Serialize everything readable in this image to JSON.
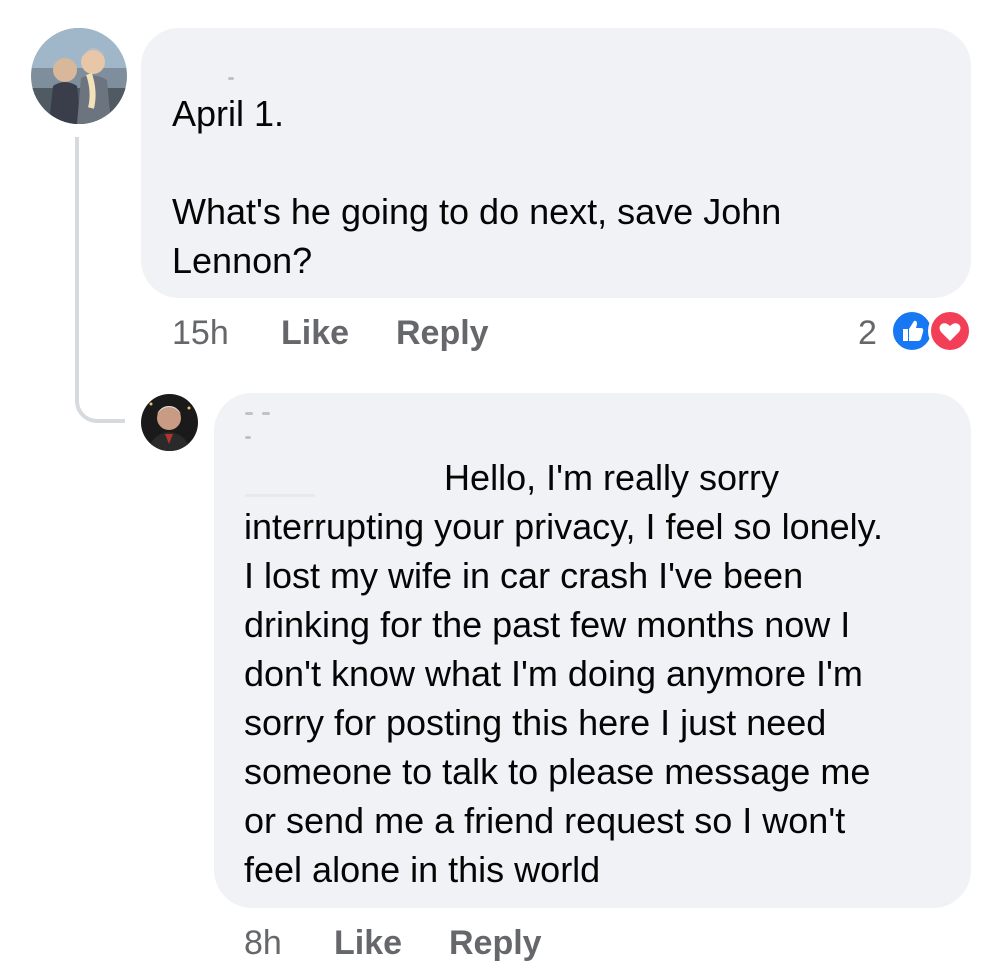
{
  "comments": [
    {
      "text": "April 1.\n\nWhat's he going to do next, save John\nLennon?",
      "time": "15h",
      "like_label": "Like",
      "reply_label": "Reply",
      "reaction_count": "2",
      "reactions": [
        "like-icon",
        "love-icon"
      ]
    },
    {
      "text": "                    Hello, I'm really sorry\ninterrupting your privacy, I feel so lonely.\nI lost my wife in car crash I've been\ndrinking for the past few months now I\ndon't know what I'm doing anymore I'm\nsorry for posting this here I just need\nsomeone to talk to please message me\nor send me a friend request so I won't\nfeel alone in this world",
      "time": "8h",
      "like_label": "Like",
      "reply_label": "Reply"
    }
  ],
  "colors": {
    "bubble": "#f0f2f5",
    "meta_text": "#65676b",
    "like_blue": "#1877f2",
    "love_red": "#f33e58"
  }
}
